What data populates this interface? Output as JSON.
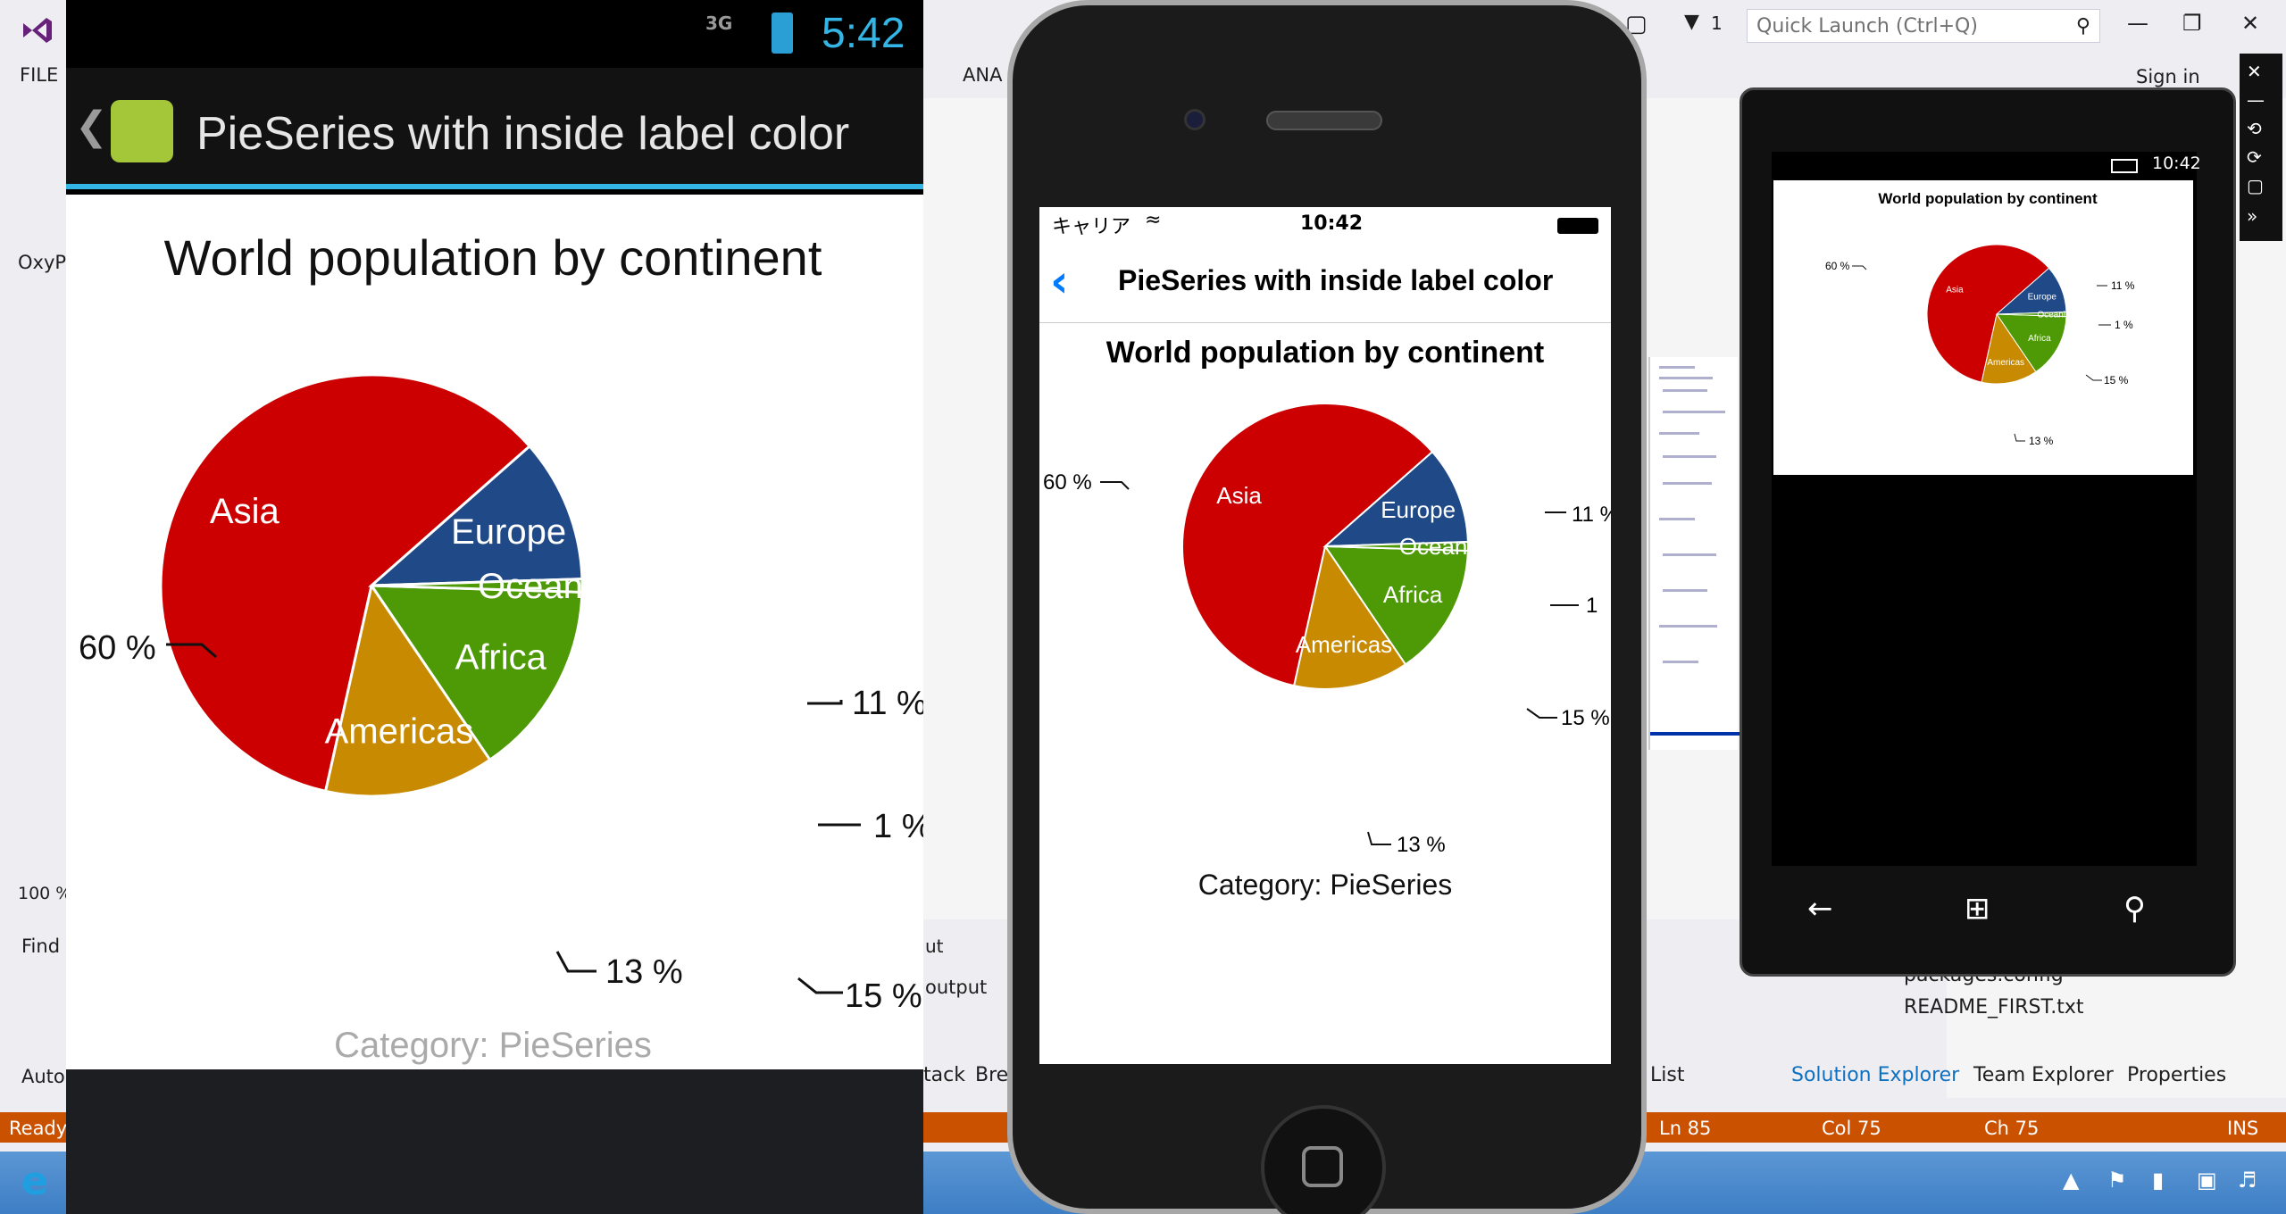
{
  "vs": {
    "menu": {
      "file": "FILE",
      "analyze": "ANA",
      "signin": "Sign in"
    },
    "quick_launch_placeholder": "Quick Launch (Ctrl+Q)",
    "filter_count": "1",
    "left_labels": {
      "oxy": "OxyP",
      "zoom": "100 %",
      "find": "Find",
      "auto": "Auto",
      "ready": "Ready"
    },
    "output_label": "output",
    "ut_label": "ut",
    "solution_files": [
      "packages.config",
      "README_FIRST.txt"
    ],
    "bottom_tabs": {
      "stack": "tack",
      "bre": "Bre",
      "list": "List",
      "solution_explorer": "Solution Explorer",
      "team_explorer": "Team Explorer",
      "properties": "Properties"
    },
    "status": {
      "ready": "Ready",
      "ln": "Ln 85",
      "col": "Col 75",
      "ch": "Ch 75",
      "ins": "INS"
    },
    "accent": "#ca5100"
  },
  "android": {
    "status_net": "3G",
    "time": "5:42",
    "title": "PieSeries with inside label color",
    "plot_title": "World population by continent",
    "category_label": "Category: PieSeries",
    "labels": {
      "asia_pct": "60 %",
      "europe_pct": "11 %",
      "oceania_pct": "1 %",
      "africa_pct": "15 %",
      "americas_pct": "13 %"
    },
    "colors": {
      "accent": "#33b5e5"
    }
  },
  "ios": {
    "carrier": "キャリア",
    "time": "10:42",
    "title": "PieSeries with inside label color",
    "plot_title": "World population by continent",
    "category_label": "Category: PieSeries",
    "labels": {
      "asia_pct": "60 %",
      "europe_pct": "11 %",
      "oceania_pct": "1",
      "africa_pct": "15 %",
      "americas_pct": "13 %"
    },
    "colors": {
      "accent": "#007aff"
    }
  },
  "wp": {
    "time": "10:42",
    "plot_title": "World population by continent",
    "labels": {
      "asia_pct": "60 %",
      "europe_pct": "11 %",
      "oceania_pct": "1 %",
      "africa_pct": "15 %",
      "americas_pct": "13 %"
    }
  },
  "chart_data": {
    "type": "pie",
    "title": "World population by continent",
    "category_label": "Category: PieSeries",
    "slices": [
      {
        "label": "Africa",
        "value": 15,
        "color": "#4d9a06"
      },
      {
        "label": "Americas",
        "value": 13,
        "color": "#c88a00"
      },
      {
        "label": "Asia",
        "value": 60,
        "color": "#cc0000"
      },
      {
        "label": "Europe",
        "value": 11,
        "color": "#204a87"
      },
      {
        "label": "Oceania",
        "value": 1,
        "color": "#4d9a06"
      }
    ],
    "inside_label_color": "#ffffff"
  }
}
